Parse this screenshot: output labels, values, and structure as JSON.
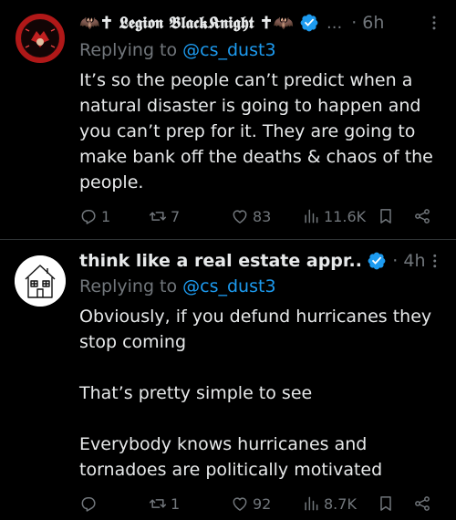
{
  "posts": [
    {
      "display_name": "🦇✝ 𝕷𝖊𝖌𝖎𝖔𝖓 𝕭𝖑𝖆𝖈𝖐𝕶𝖓𝖎𝖌𝖍𝖙 ✝🦇",
      "truncation": "...",
      "time": "· 6h",
      "replying_prefix": "Replying to ",
      "replying_handle": "@cs_dust3",
      "body": [
        "It’s so the people can’t predict when a natural disaster is going to happen and you can’t prep for it. They are going to make bank off the deaths & chaos of the people."
      ],
      "replies": "1",
      "reposts": "7",
      "likes": "83",
      "views": "11.6K"
    },
    {
      "display_name": "think like a real estate appr...",
      "time": "· 4h",
      "replying_prefix": "Replying to ",
      "replying_handle": "@cs_dust3",
      "body": [
        "Obviously, if you defund hurricanes they stop coming",
        "",
        "That’s pretty simple to see",
        "",
        "Everybody knows hurricanes and tornadoes are politically motivated"
      ],
      "replies": "",
      "reposts": "1",
      "likes": "92",
      "views": "8.7K"
    }
  ],
  "colors": {
    "text": "#e7e9ea",
    "muted": "#71767b",
    "link": "#1d9bf0",
    "verified": "#1d9bf0",
    "divider": "#2f3336"
  },
  "icons": [
    "verified-badge-icon",
    "more-options-icon",
    "reply-icon",
    "repost-icon",
    "like-icon",
    "views-icon",
    "bookmark-icon",
    "share-icon"
  ]
}
